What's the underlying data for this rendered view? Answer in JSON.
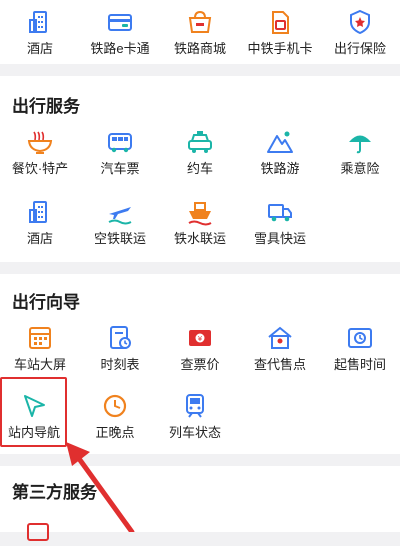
{
  "top_row": [
    {
      "label": "酒店",
      "icon": "hotel-icon"
    },
    {
      "label": "铁路e卡通",
      "icon": "rail-card-icon"
    },
    {
      "label": "铁路商城",
      "icon": "rail-mall-icon"
    },
    {
      "label": "中铁手机卡",
      "icon": "sim-card-icon"
    },
    {
      "label": "出行保险",
      "icon": "insurance-shield-icon"
    }
  ],
  "travel_services": {
    "title": "出行服务",
    "rows": [
      [
        {
          "label": "餐饮·特产",
          "icon": "noodle-bowl-icon"
        },
        {
          "label": "汽车票",
          "icon": "bus-icon"
        },
        {
          "label": "约车",
          "icon": "taxi-icon"
        },
        {
          "label": "铁路游",
          "icon": "mountain-icon"
        },
        {
          "label": "乘意险",
          "icon": "umbrella-icon"
        }
      ],
      [
        {
          "label": "酒店",
          "icon": "hotel-icon"
        },
        {
          "label": "空铁联运",
          "icon": "plane-icon"
        },
        {
          "label": "铁水联运",
          "icon": "ship-icon"
        },
        {
          "label": "雪具快运",
          "icon": "truck-icon"
        }
      ]
    ]
  },
  "travel_guide": {
    "title": "出行向导",
    "rows": [
      [
        {
          "label": "车站大屏",
          "icon": "station-board-icon"
        },
        {
          "label": "时刻表",
          "icon": "timetable-icon"
        },
        {
          "label": "查票价",
          "icon": "ticket-price-icon"
        },
        {
          "label": "查代售点",
          "icon": "agency-house-icon"
        },
        {
          "label": "起售时间",
          "icon": "sale-time-icon"
        }
      ],
      [
        {
          "label": "站内导航",
          "icon": "navigation-arrow-icon"
        },
        {
          "label": "正晚点",
          "icon": "clock-icon"
        },
        {
          "label": "列车状态",
          "icon": "train-icon"
        }
      ]
    ]
  },
  "third_party": {
    "title": "第三方服务"
  },
  "colors": {
    "blue": "#3d7bf0",
    "teal": "#1bb5a8",
    "orange": "#f0821e",
    "red": "#e02f2f",
    "background": "#f1f1f3"
  }
}
